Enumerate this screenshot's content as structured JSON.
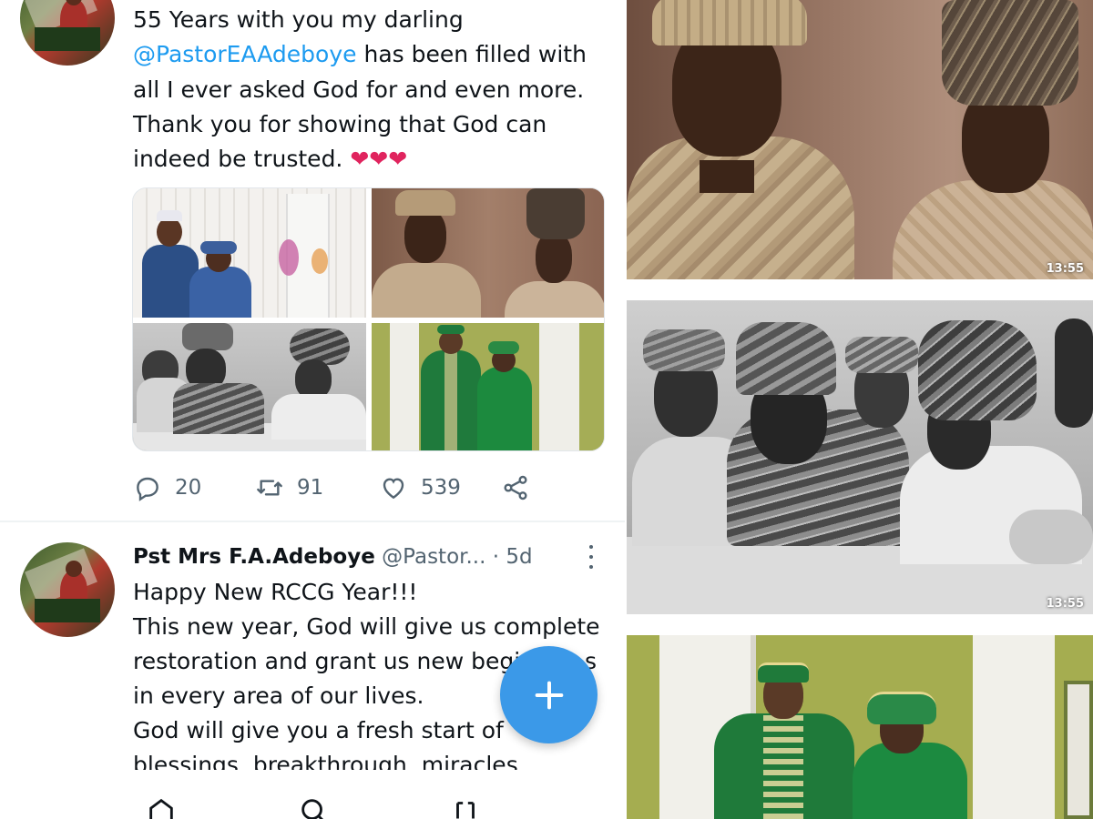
{
  "colors": {
    "accent": "#1d9bf0",
    "text_primary": "#0f1419",
    "text_secondary": "#536471",
    "heart": "#e0245e",
    "fab": "#3b99e8"
  },
  "tweet1": {
    "lines": [
      "55 Years with you my darling",
      "has been filled with",
      "all I ever asked God for and even more.",
      "Thank you for showing that God can",
      "indeed be trusted."
    ],
    "mention": "@PastorEAAdeboye",
    "hearts": "❤❤❤",
    "stats": {
      "replies": "20",
      "retweets": "91",
      "likes": "539"
    }
  },
  "tweet2": {
    "display_name": "Pst Mrs F.A.Adeboye",
    "handle": "@Pastor...",
    "time": "· 5d",
    "lines": [
      "Happy New RCCG Year!!!",
      "This new year, God will give us complete",
      "restoration and grant us new begi",
      "in every area of our lives.",
      "God will give you a fresh start of",
      "blessings, breakthrough, miracles"
    ],
    "hidden_fragment": "s"
  },
  "media": {
    "durations": [
      "13:55",
      "13:55"
    ]
  },
  "icons": {
    "reply": "reply-icon",
    "retweet": "retweet-icon",
    "like": "heart-icon",
    "share": "share-icon",
    "compose": "plus-icon",
    "more": "more-vertical-icon"
  }
}
